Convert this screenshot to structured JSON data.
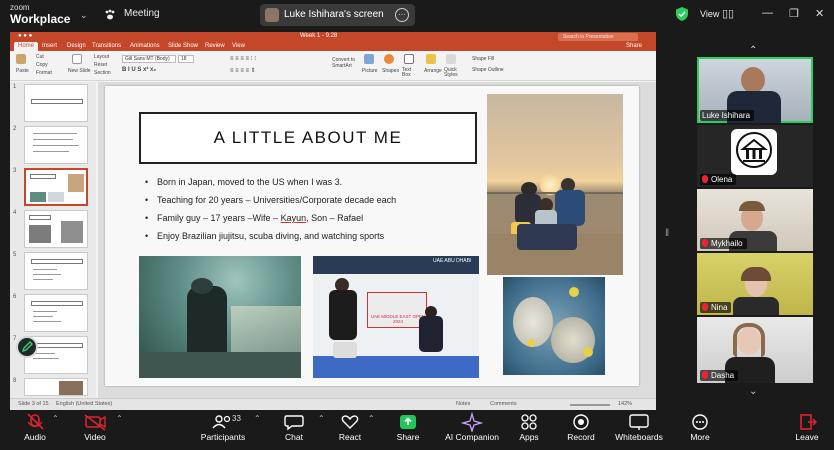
{
  "app": {
    "brand_small": "zoom",
    "brand_big": "Workplace",
    "meeting_label": "Meeting",
    "shared_screen": "Luke Ishihara's screen",
    "view_label": "View"
  },
  "ppt": {
    "doc_title": "Week 1 - 9.28",
    "search_placeholder": "Search in Presentation",
    "share_label": "Share",
    "tabs": [
      "Home",
      "Insert",
      "Design",
      "Transitions",
      "Animations",
      "Slide Show",
      "Review",
      "View"
    ],
    "ribbon": {
      "paste": "Paste",
      "cut": "Cut",
      "copy": "Copy",
      "format": "Format",
      "new_slide": "New Slide",
      "layout": "Layout",
      "reset": "Reset",
      "section": "Section",
      "font": "Gill Sans MT (Body)",
      "size": "18",
      "convert": "Convert to SmartArt",
      "picture": "Picture",
      "shapes": "Shapes",
      "textbox": "Text Box",
      "arrange": "Arrange",
      "quick_styles": "Quick Styles",
      "shape_fill": "Shape Fill",
      "shape_outline": "Shape Outline"
    },
    "thumbnails": [
      "1",
      "2",
      "3",
      "4",
      "5",
      "6",
      "7",
      "8"
    ],
    "status": {
      "slide_of": "Slide 3 of 15",
      "language": "English (United States)",
      "notes": "Notes",
      "comments": "Comments",
      "zoom": "142%"
    }
  },
  "slide": {
    "title": "A LITTLE ABOUT ME",
    "bullets": [
      "Born in Japan, moved to the US when I was 3.",
      "Teaching for 20 years – Universities/Corporate decade each",
      "Family guy – 17 years –Wife – Kayun, Son – Rafael",
      "Enjoy Brazilian jiujitsu, scuba diving, and watching sports"
    ],
    "bullet3_parts": [
      "Family guy – 17 years –Wife – ",
      "Kayun",
      ", Son – Rafael"
    ],
    "banner_text": "UAE ABU DHABI",
    "banner_sub": "UAE MIDDLE EAST OPEN 2024"
  },
  "participants": [
    {
      "name": "Luke Ishihara",
      "muted": false
    },
    {
      "name": "Olena",
      "muted": true
    },
    {
      "name": "Mykhailo",
      "muted": true
    },
    {
      "name": "Nina",
      "muted": true
    },
    {
      "name": "Dasha",
      "muted": true
    }
  ],
  "toolbar": {
    "audio": "Audio",
    "video": "Video",
    "participants": "Participants",
    "participants_count": "33",
    "chat": "Chat",
    "react": "React",
    "share": "Share",
    "ai": "AI Companion",
    "apps": "Apps",
    "record": "Record",
    "whiteboards": "Whiteboards",
    "more": "More",
    "leave": "Leave"
  },
  "colors": {
    "ppt_accent": "#c4472a",
    "active_speaker": "#2ecc5c",
    "share_green": "#23c45a",
    "muted_red": "#e02233"
  }
}
